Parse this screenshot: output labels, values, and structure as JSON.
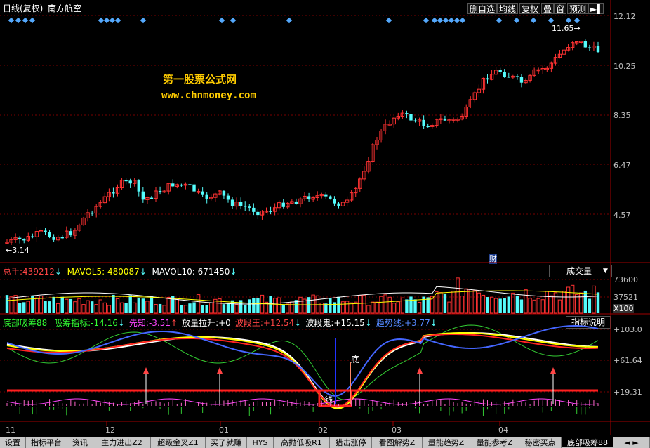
{
  "header": {
    "label": "日线(复权)",
    "stock": "南方航空",
    "buttons": [
      "删自选",
      "均线",
      "复权",
      "叠",
      "窗",
      "预测"
    ],
    "play_icon": "play-pause-icon"
  },
  "watermark": {
    "line1": "第一股票公式网",
    "line2": "www.chnmoney.com"
  },
  "price_panel": {
    "y_labels": [
      "12.12",
      "10.25",
      "8.35",
      "6.47",
      "4.57"
    ],
    "high_label": "11.65",
    "low_label": "3.14",
    "event_marker": "财"
  },
  "volume_panel": {
    "total_label": "总手:",
    "total_value": "439212",
    "ma5_label": "MAVOL5:",
    "ma5_value": "480087",
    "ma10_label": "MAVOL10:",
    "ma10_value": "671450",
    "selector": "成交量",
    "y_labels": [
      "73600",
      "37521",
      "X100"
    ]
  },
  "indicator_panel": {
    "name": "底部吸筹88",
    "items": [
      {
        "label": "吸筹指标:",
        "value": "-14.16",
        "color": "#33ff33",
        "arrow": "↓"
      },
      {
        "label": "先知:",
        "value": "-3.51",
        "color": "#ff44ff",
        "arrow": "↑"
      },
      {
        "label": "放量拉升:",
        "value": "+0",
        "color": "#ffffff",
        "arrow": ""
      },
      {
        "label": "波段王:",
        "value": "+12.54",
        "color": "#ff4444",
        "arrow": "↓"
      },
      {
        "label": "波段鬼:",
        "value": "+15.15",
        "color": "#ffffff",
        "arrow": "↓"
      },
      {
        "label": "趋势线:",
        "value": "+3.77",
        "color": "#5588ff",
        "arrow": "↓"
      }
    ],
    "explain_button": "指标说明",
    "y_labels": [
      "+103.0",
      "+61.64",
      "+19.31"
    ],
    "annot_bottom": "底",
    "annot_low": "钱"
  },
  "x_axis": {
    "labels": [
      "11",
      "12",
      "01",
      "02",
      "03",
      "04"
    ]
  },
  "tabs": [
    "设置",
    "指标平台",
    "资讯",
    "主力进出Z2",
    "超级金叉Z1",
    "买了就赚",
    "HYS",
    "高抛低吸R1",
    "猎击涨停",
    "看图解势Z",
    "量能趋势Z",
    "量能参考Z",
    "秘密买点",
    "底部吸筹88"
  ],
  "colors": {
    "up": "#ff3232",
    "down": "#54fcfc",
    "grid": "#7a0000",
    "diamond": "#54a8fc",
    "ma_white": "#ffffff",
    "ma_yellow": "#ffff00"
  }
}
